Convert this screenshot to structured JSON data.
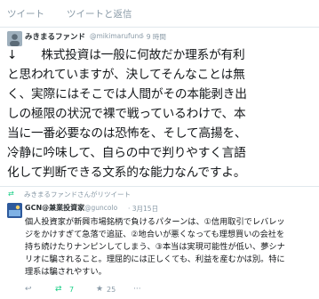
{
  "tabs": [
    {
      "label": "ツイート"
    },
    {
      "label": "ツイートと返信"
    }
  ],
  "tweet1": {
    "name": "みきまるファンド",
    "handle": "@mikimarufund",
    "time": "· 9 時間",
    "lines": [
      "↓　　株式投資は一般に何故だか理系が有利",
      "と思われていますが、決してそんなことは無",
      "く、実際にはそこでは人間がその本能剥き出",
      "しの極限の状況で裸で戦っているわけで、本",
      "当に一番必要なのは恐怖を、そして高揚を、",
      "冷静に吟味して、自らの中で判りやすく言語",
      "化して判断できる文系的な能力なんですよ。"
    ]
  },
  "retweet_notice": {
    "icon": "retweet-icon",
    "text": "みきまるファンドさんがリツイート"
  },
  "tweet2": {
    "name": "GCN@兼業投資家",
    "handle": "@guncolo",
    "time": "· 3月15日",
    "lines": [
      "個人投資家が新興市場銘柄で負けるパターンは、①信用取引でレバレッ",
      "ジをかけすぎて急落で追証、②地合いが悪くなっても理想買いの会社を",
      "持ち続けたりナンピンしてしまう、③本当は実現可能性が低い、夢シナ",
      "リオに騙されること。理屈的には正しくても、利益を産むかは別。特に",
      "理系は騙されやすい。"
    ],
    "actions": {
      "reply_icon": "reply-icon",
      "retweet_icon": "retweet-icon",
      "retweet_count": "7",
      "favorite_icon": "star-icon",
      "favorite_count": "25",
      "more_icon": "more-icon"
    }
  },
  "colors": {
    "accent_green": "#19cf86",
    "muted": "#8899a6",
    "text": "#14171a"
  }
}
